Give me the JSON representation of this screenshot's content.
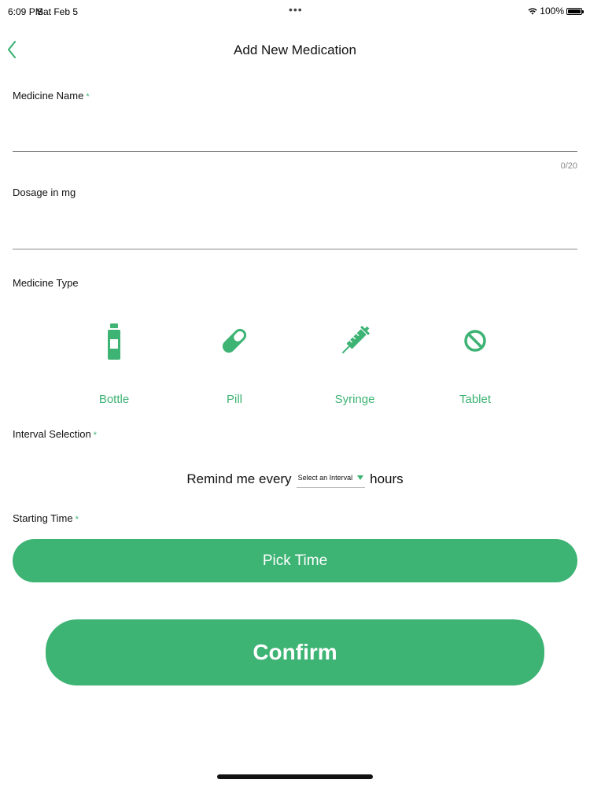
{
  "status_bar": {
    "time": "6:09 PM",
    "date": "Sat Feb 5",
    "dots": "•••",
    "battery": "100%"
  },
  "nav": {
    "title": "Add New Medication"
  },
  "form": {
    "medicine_name": {
      "label": "Medicine Name",
      "required_mark": "*",
      "value": "",
      "counter": "0/20"
    },
    "dosage": {
      "label": "Dosage in mg",
      "value": ""
    },
    "medicine_type": {
      "label": "Medicine Type",
      "options": [
        {
          "label": "Bottle",
          "icon": "bottle-icon"
        },
        {
          "label": "Pill",
          "icon": "pill-icon"
        },
        {
          "label": "Syringe",
          "icon": "syringe-icon"
        },
        {
          "label": "Tablet",
          "icon": "tablet-icon"
        }
      ]
    },
    "interval": {
      "label": "Interval Selection",
      "required_mark": "*",
      "prefix": "Remind me every",
      "select_placeholder": "Select an Interval",
      "suffix": "hours"
    },
    "starting_time": {
      "label": "Starting Time",
      "required_mark": "*",
      "button_label": "Pick Time"
    }
  },
  "confirm_label": "Confirm",
  "colors": {
    "accent": "#3db374"
  }
}
